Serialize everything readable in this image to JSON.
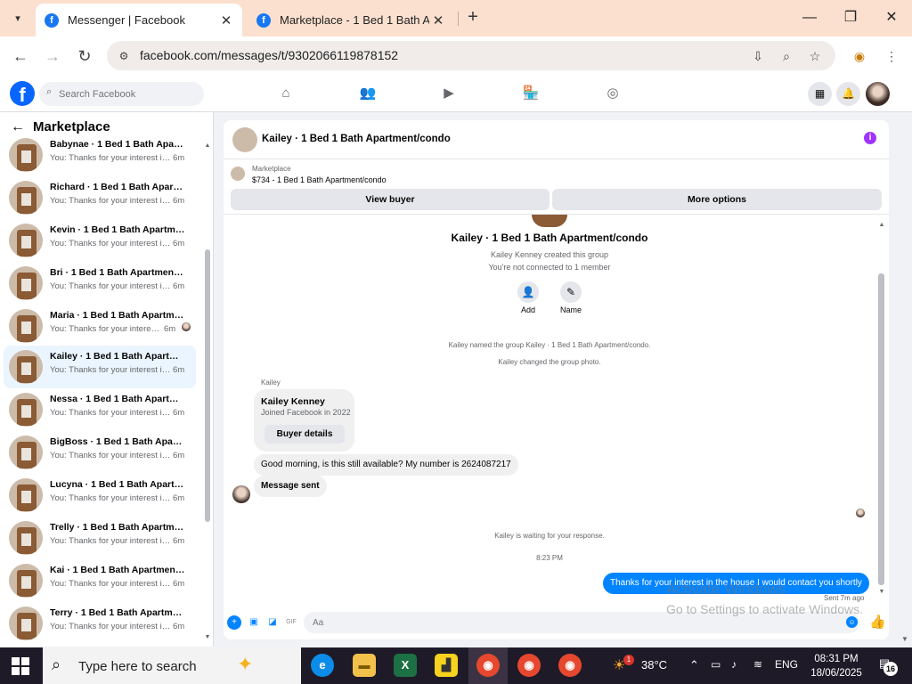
{
  "browser": {
    "tabs": [
      {
        "title": "Messenger | Facebook",
        "active": true
      },
      {
        "title": "Marketplace - 1 Bed 1 Bath Apa",
        "active": false
      }
    ],
    "url": "facebook.com/messages/t/9302066119878152"
  },
  "facebook": {
    "search_placeholder": "Search Facebook",
    "logo_letter": "f"
  },
  "sidebar": {
    "title": "Marketplace",
    "conversations": [
      {
        "name": "Babynae · 1 Bed 1 Bath Apartm...",
        "preview": "You: Thanks for your interest in t...",
        "time": "6m"
      },
      {
        "name": "Richard · 1 Bed 1 Bath Apartme...",
        "preview": "You: Thanks for your interest in t...",
        "time": "6m"
      },
      {
        "name": "Kevin · 1 Bed 1 Bath Apartment...",
        "preview": "You: Thanks for your interest in t...",
        "time": "6m"
      },
      {
        "name": "Bri · 1 Bed 1 Bath Apartment/co...",
        "preview": "You: Thanks for your interest in t...",
        "time": "6m"
      },
      {
        "name": "Maria · 1 Bed 1 Bath Apartme...",
        "preview": "You: Thanks for your interest i...",
        "time": "6m"
      },
      {
        "name": "Kailey · 1 Bed 1 Bath Apartment...",
        "preview": "You: Thanks for your interest in t...",
        "time": "6m"
      },
      {
        "name": "Nessa · 1 Bed 1 Bath Apartment...",
        "preview": "You: Thanks for your interest in t...",
        "time": "6m"
      },
      {
        "name": "BigBoss · 1 Bed 1 Bath Apartme...",
        "preview": "You: Thanks for your interest in t...",
        "time": "6m"
      },
      {
        "name": "Lucyna · 1 Bed 1 Bath Apartmen...",
        "preview": "You: Thanks for your interest in t...",
        "time": "6m"
      },
      {
        "name": "Trelly · 1 Bed 1 Bath Apartment/...",
        "preview": "You: Thanks for your interest in t...",
        "time": "6m"
      },
      {
        "name": "Kai · 1 Bed 1 Bath Apartment/c...",
        "preview": "You: Thanks for your interest in t...",
        "time": "6m"
      },
      {
        "name": "Terry · 1 Bed 1 Bath Apartment/...",
        "preview": "You: Thanks for your interest in t...",
        "time": "6m"
      }
    ]
  },
  "chat": {
    "header_title": "Kailey · 1 Bed 1 Bath Apartment/condo",
    "marketplace_label": "Marketplace",
    "listing": "$734 - 1 Bed 1 Bath Apartment/condo",
    "view_buyer": "View buyer",
    "more_options": "More options",
    "group_title": "Kailey · 1 Bed 1 Bath Apartment/condo",
    "group_created": "Kailey Kenney created this group",
    "not_connected": "You're not connected to 1 member",
    "add_label": "Add",
    "name_label": "Name",
    "sys_named": "Kailey named the group Kailey · 1 Bed 1 Bath Apartment/condo.",
    "sys_photo": "Kailey changed the group photo.",
    "sender": "Kailey",
    "card_name": "Kailey Kenney",
    "card_joined": "Joined Facebook in 2022",
    "buyer_details": "Buyer details",
    "msg_in": "Good morning, is this still available? My number is 2624087217",
    "msg_sent_auto": "Message sent",
    "waiting": "Kailey is waiting for your response.",
    "time": "8:23 PM",
    "msg_out": "Thanks for your interest in the house I would contact you shortly",
    "sent_ago": "Sent 7m ago",
    "composer_placeholder": "Aa"
  },
  "watermark": {
    "line1": "Activate Windows",
    "line2": "Go to Settings to activate Windows."
  },
  "taskbar": {
    "search_text": "Type here to search",
    "weather": "38°C",
    "weather_badge": "1",
    "language": "ENG",
    "time": "08:31 PM",
    "date": "18/06/2025",
    "notifications": "16"
  }
}
